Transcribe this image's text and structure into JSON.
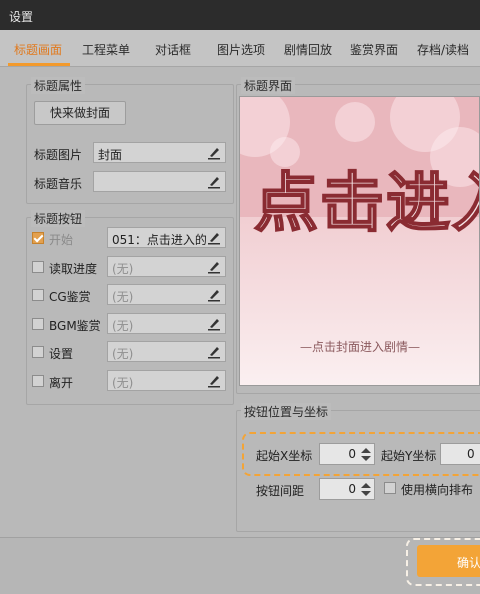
{
  "window": {
    "title": "设置"
  },
  "tabs": [
    {
      "label": "标题画面"
    },
    {
      "label": "工程菜单"
    },
    {
      "label": "对话框"
    },
    {
      "label": "图片选项"
    },
    {
      "label": "剧情回放"
    },
    {
      "label": "鉴赏界面"
    },
    {
      "label": "存档/读档"
    }
  ],
  "title_props": {
    "group_label": "标题属性",
    "quick_cover_button": "快来做封面",
    "image_label": "标题图片",
    "image_value": "封面",
    "music_label": "标题音乐",
    "music_value": ""
  },
  "title_buttons": {
    "group_label": "标题按钮",
    "items": [
      {
        "label": "开始",
        "value": "051：点击进入的",
        "checked": true
      },
      {
        "label": "读取进度",
        "value": "(无)",
        "checked": false
      },
      {
        "label": "CG鉴赏",
        "value": "(无)",
        "checked": false
      },
      {
        "label": "BGM鉴赏",
        "value": "(无)",
        "checked": false
      },
      {
        "label": "设置",
        "value": "(无)",
        "checked": false
      },
      {
        "label": "离开",
        "value": "(无)",
        "checked": false
      }
    ]
  },
  "title_screen": {
    "group_label": "标题界面",
    "preview_title": "点击进入",
    "preview_subtitle": "—点击封面进入剧情—"
  },
  "button_position": {
    "group_label": "按钮位置与坐标",
    "start_x_label": "起始X坐标",
    "start_x_value": "0",
    "start_y_label": "起始Y坐标",
    "start_y_value": "0",
    "spacing_label": "按钮间距",
    "spacing_value": "0",
    "horizontal_label": "使用横向排布",
    "horizontal_checked": false
  },
  "footer": {
    "ok_label": "确认"
  },
  "colors": {
    "accent": "#f3a437",
    "active_tab": "#e07a1f"
  }
}
